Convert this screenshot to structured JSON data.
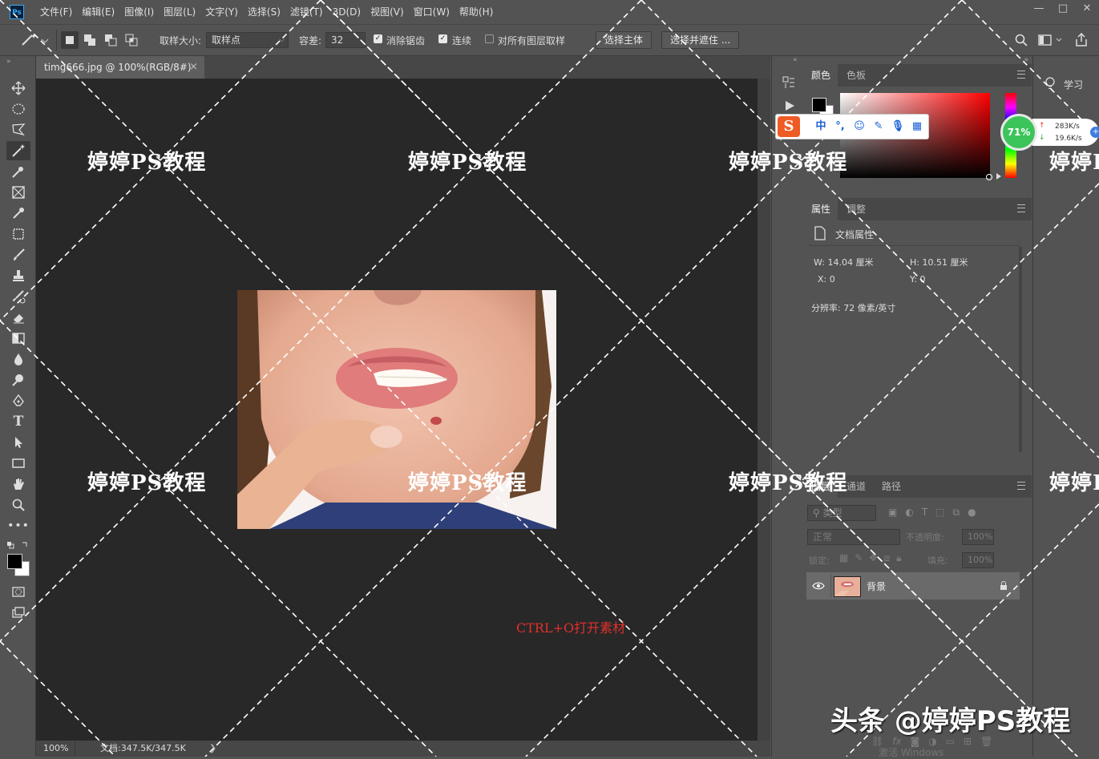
{
  "app": {
    "logo_text": "Ps"
  },
  "menu": [
    "文件(F)",
    "编辑(E)",
    "图像(I)",
    "图层(L)",
    "文字(Y)",
    "选择(S)",
    "滤镜(T)",
    "3D(D)",
    "视图(V)",
    "窗口(W)",
    "帮助(H)"
  ],
  "window_controls": {
    "minimize": "—",
    "maximize": "□",
    "close": "✕"
  },
  "options": {
    "sample_size_label": "取样大小:",
    "sample_size_value": "取样点",
    "tolerance_label": "容差:",
    "tolerance_value": "32",
    "antialias_label": "消除锯齿",
    "antialias_checked": true,
    "contiguous_label": "连续",
    "contiguous_checked": true,
    "sample_all_label": "对所有图层取样",
    "sample_all_checked": false,
    "select_subject_label": "选择主体",
    "select_mask_label": "选择并遮住 ..."
  },
  "document": {
    "tab_title": "timg666.jpg @ 100%(RGB/8#)",
    "tab_close": "×",
    "zoom": "100%",
    "doc_info": "文档:347.5K/347.5K"
  },
  "canvas_text": {
    "hint": "CTRL+O打开素材",
    "hint_color": "#e3302b"
  },
  "watermark": {
    "text": "婷婷PS教程",
    "credit": "头条 @婷婷PS教程"
  },
  "color_panel": {
    "tabs": [
      "颜色",
      "色板"
    ],
    "foreground": "#000000",
    "background": "#ffffff",
    "hue": "#ff0000"
  },
  "properties_panel": {
    "tabs": [
      "属性",
      "调整"
    ],
    "title": "文档属性",
    "w_label": "W:",
    "w_value": "14.04 厘米",
    "h_label": "H:",
    "h_value": "10.51 厘米",
    "x_label": "X:",
    "x_value": "0",
    "y_label": "Y:",
    "y_value": "0",
    "resolution": "分辨率: 72 像素/英寸"
  },
  "layers_panel": {
    "tabs": [
      "图层",
      "通道",
      "路径"
    ],
    "filter_label": "类型",
    "blend_mode": "正常",
    "opacity_label": "不透明度:",
    "opacity_value": "100%",
    "lock_label": "锁定:",
    "fill_label": "填充:",
    "fill_value": "100%",
    "layers": [
      {
        "name": "背景",
        "visible": true,
        "locked": true
      }
    ],
    "footer_icons": [
      "link-icon",
      "fx-icon",
      "mask-icon",
      "adjustment-icon",
      "group-icon",
      "new-layer-icon",
      "trash-icon"
    ]
  },
  "learn_panel": {
    "label": "学习"
  },
  "ime": {
    "logo": "S",
    "mode": "中",
    "punct": "°,"
  },
  "network_widget": {
    "percent": "71%",
    "up": "283K/s",
    "down": "19.6K/s"
  },
  "tools": [
    "move-tool",
    "marquee-tool",
    "lasso-tool",
    "magic-wand-tool",
    "quick-select-tool",
    "frame-tool",
    "eyedropper-tool",
    "crop-tool",
    "brush-tool",
    "stamp-tool",
    "history-brush-tool",
    "eraser-tool",
    "gradient-tool",
    "blur-tool",
    "dodge-tool",
    "pen-tool",
    "type-tool",
    "path-select-tool",
    "rectangle-tool",
    "hand-tool",
    "zoom-tool",
    "more-tools"
  ],
  "watermark_overlay_text": "激活 Windows"
}
